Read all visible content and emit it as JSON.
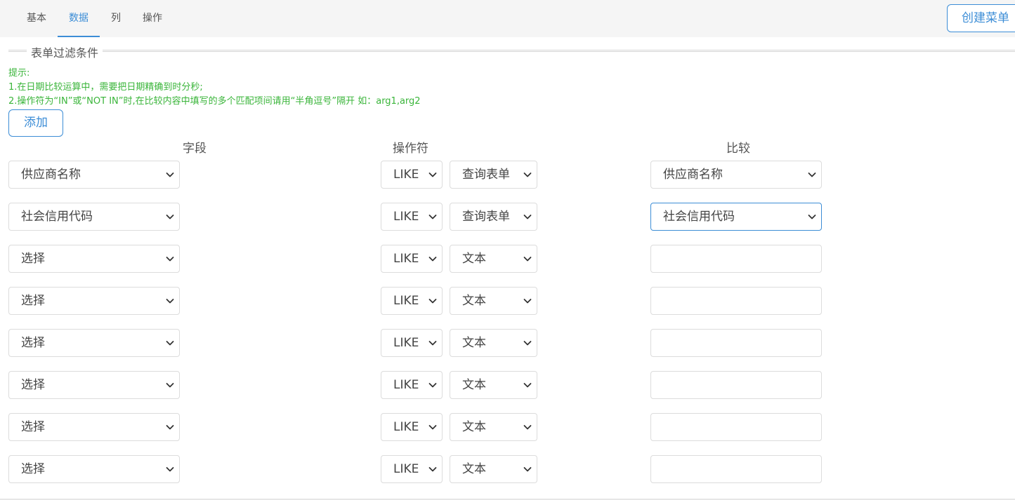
{
  "tabs": [
    {
      "label": "基本"
    },
    {
      "label": "数据"
    },
    {
      "label": "列"
    },
    {
      "label": "操作"
    }
  ],
  "active_tab": "数据",
  "create_button": "创建菜单",
  "section_title": "表单过滤条件",
  "hint_lines": [
    "提示:",
    "1.在日期比较运算中，需要把日期精确到时分秒;",
    "2.操作符为“IN”或“NOT IN”时,在比较内容中填写的多个匹配项间请用“半角逗号”隔开 如：arg1,arg2"
  ],
  "add_button": "添加",
  "columns": {
    "field": "字段",
    "operator": "操作符",
    "compare": "比较"
  },
  "rows": [
    {
      "field": "供应商名称",
      "operator": "LIKE",
      "source": "查询表单",
      "compare": "供应商名称",
      "compare_type": "select"
    },
    {
      "field": "社会信用代码",
      "operator": "LIKE",
      "source": "查询表单",
      "compare": "社会信用代码",
      "compare_type": "select"
    },
    {
      "field": "选择",
      "operator": "LIKE",
      "source": "文本",
      "compare": "",
      "compare_type": "text"
    },
    {
      "field": "选择",
      "operator": "LIKE",
      "source": "文本",
      "compare": "",
      "compare_type": "text"
    },
    {
      "field": "选择",
      "operator": "LIKE",
      "source": "文本",
      "compare": "",
      "compare_type": "text"
    },
    {
      "field": "选择",
      "operator": "LIKE",
      "source": "文本",
      "compare": "",
      "compare_type": "text"
    },
    {
      "field": "选择",
      "operator": "LIKE",
      "source": "文本",
      "compare": "",
      "compare_type": "text"
    },
    {
      "field": "选择",
      "operator": "LIKE",
      "source": "文本",
      "compare": "",
      "compare_type": "text"
    }
  ],
  "colors": {
    "accent": "#3c8dd6",
    "hint": "#3ab53a",
    "border": "#dcdcdc"
  }
}
